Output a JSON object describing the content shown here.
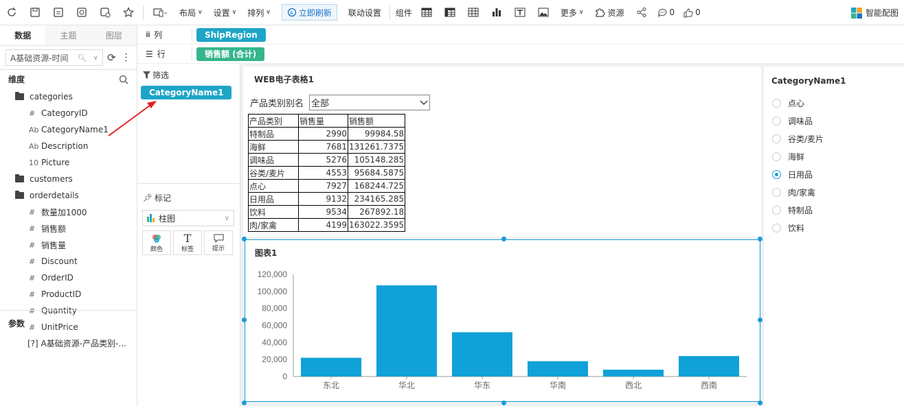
{
  "toolbar": {
    "icons": [
      "refresh-icon",
      "save-icon",
      "save-as-icon",
      "preview-icon",
      "export-icon",
      "star-icon"
    ],
    "device_icon": "device-icon",
    "layout": "布局",
    "settings": "设置",
    "arrange": "排列",
    "refresh_now": "立即刷新",
    "link_settings": "联动设置",
    "components": "组件",
    "component_icons": [
      "table-icon",
      "crosstab-icon",
      "grid-icon",
      "bar-chart-icon",
      "text-icon",
      "image-icon"
    ],
    "more": "更多",
    "resources": "资源",
    "comment_count": "0",
    "like_count": "0",
    "smart": "智能配图"
  },
  "left": {
    "tabs": [
      "数据",
      "主题",
      "图层"
    ],
    "source": "A基础资源-时间",
    "dimension_title": "维度",
    "tree": [
      {
        "kind": "folder",
        "label": "categories"
      },
      {
        "kind": "field",
        "type": "#",
        "label": "CategoryID"
      },
      {
        "kind": "field",
        "type": "Ab",
        "label": "CategoryName1"
      },
      {
        "kind": "field",
        "type": "Ab",
        "label": "Description"
      },
      {
        "kind": "field",
        "type": "10",
        "label": "Picture"
      },
      {
        "kind": "folder",
        "label": "customers"
      },
      {
        "kind": "folder",
        "label": "orderdetails"
      },
      {
        "kind": "field",
        "type": "#",
        "label": "数量加1000"
      },
      {
        "kind": "field",
        "type": "#",
        "label": "销售额"
      },
      {
        "kind": "field",
        "type": "#",
        "label": "销售量"
      },
      {
        "kind": "field",
        "type": "#",
        "label": "Discount"
      },
      {
        "kind": "field",
        "type": "#",
        "label": "OrderID"
      },
      {
        "kind": "field",
        "type": "#",
        "label": "ProductID"
      },
      {
        "kind": "field",
        "type": "#",
        "label": "Quantity"
      },
      {
        "kind": "field",
        "type": "#",
        "label": "UnitPrice"
      }
    ],
    "params_title": "参数",
    "param_item": "[?] A基础资源-产品类别-..."
  },
  "shelves": {
    "col_label": "列",
    "col_pill": "ShipRegion",
    "row_label": "行",
    "row_pill": "销售额 (合计)"
  },
  "mid": {
    "filter_label": "筛选",
    "filter_pill": "CategoryName1",
    "marks_label": "标记",
    "chart_type": "柱图",
    "mark_buttons": [
      {
        "label": "颜色",
        "icon": "color-icon"
      },
      {
        "label": "标签",
        "icon": "label-text-icon"
      },
      {
        "label": "提示",
        "icon": "tooltip-icon"
      }
    ]
  },
  "sheet": {
    "title": "WEB电子表格1",
    "filter_label": "产品类别别名",
    "filter_value": "全部",
    "headers": [
      "产品类别",
      "销售量",
      "销售额"
    ],
    "rows": [
      [
        "特制品",
        "2990",
        "99984.58"
      ],
      [
        "海鲜",
        "7681",
        "131261.7375"
      ],
      [
        "调味品",
        "5276",
        "105148.285"
      ],
      [
        "谷类/麦片",
        "4553",
        "95684.5875"
      ],
      [
        "点心",
        "7927",
        "168244.725"
      ],
      [
        "日用品",
        "9132",
        "234165.285"
      ],
      [
        "饮料",
        "9534",
        "267892.18"
      ],
      [
        "肉/家禽",
        "4199",
        "163022.3595"
      ]
    ]
  },
  "chart_title": "图表1",
  "chart_data": {
    "type": "bar",
    "categories": [
      "东北",
      "华北",
      "华东",
      "华南",
      "西北",
      "西南"
    ],
    "values": [
      22000,
      107000,
      52000,
      18000,
      8000,
      24000
    ],
    "ylim": [
      0,
      120000
    ],
    "yticks": [
      "0",
      "20,000",
      "40,000",
      "60,000",
      "80,000",
      "100,000",
      "120,000"
    ],
    "bar_color": "#0fa1d8",
    "grid": false
  },
  "category_filter": {
    "title": "CategoryName1",
    "options": [
      "点心",
      "调味品",
      "谷类/麦片",
      "海鲜",
      "日用品",
      "肉/家禽",
      "特制品",
      "饮料"
    ],
    "selected": "日用品"
  },
  "colors": {
    "accent": "#1a9bd7",
    "pill_blue": "#1ea5c7",
    "pill_green": "#35b58d",
    "annotation_arrow": "#e02020"
  }
}
